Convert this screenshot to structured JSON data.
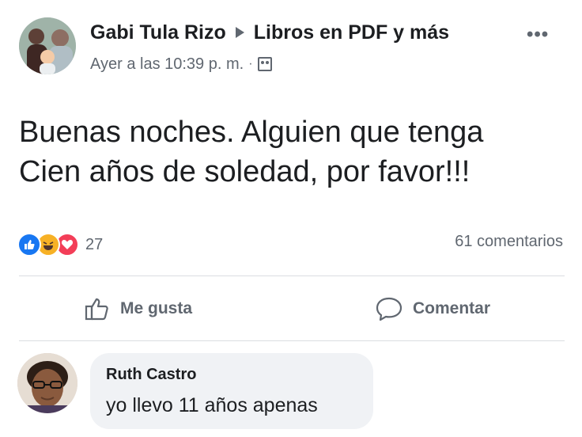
{
  "post": {
    "author": "Gabi Tula Rizo",
    "group": "Libros en PDF y más",
    "timestamp": "Ayer a las 10:39 p. m.",
    "separator": "·",
    "privacy_icon": "group-icon",
    "more_icon": "more-options-icon",
    "text_line1": "Buenas noches. Alguien que tenga",
    "text_line2": "Cien años de soledad, por favor!!!"
  },
  "stats": {
    "reaction_icons": [
      "like-reaction-icon",
      "haha-reaction-icon",
      "love-reaction-icon"
    ],
    "reaction_count": "27",
    "comments": "61 comentarios"
  },
  "actions": {
    "like_label": "Me gusta",
    "comment_label": "Comentar"
  },
  "comment": {
    "name": "Ruth Castro",
    "text": "yo llevo 11 años apenas"
  },
  "colors": {
    "facebook_blue": "#1877f2",
    "text_primary": "#1c1e21",
    "text_secondary": "#606770",
    "bubble_bg": "#f0f2f5"
  }
}
